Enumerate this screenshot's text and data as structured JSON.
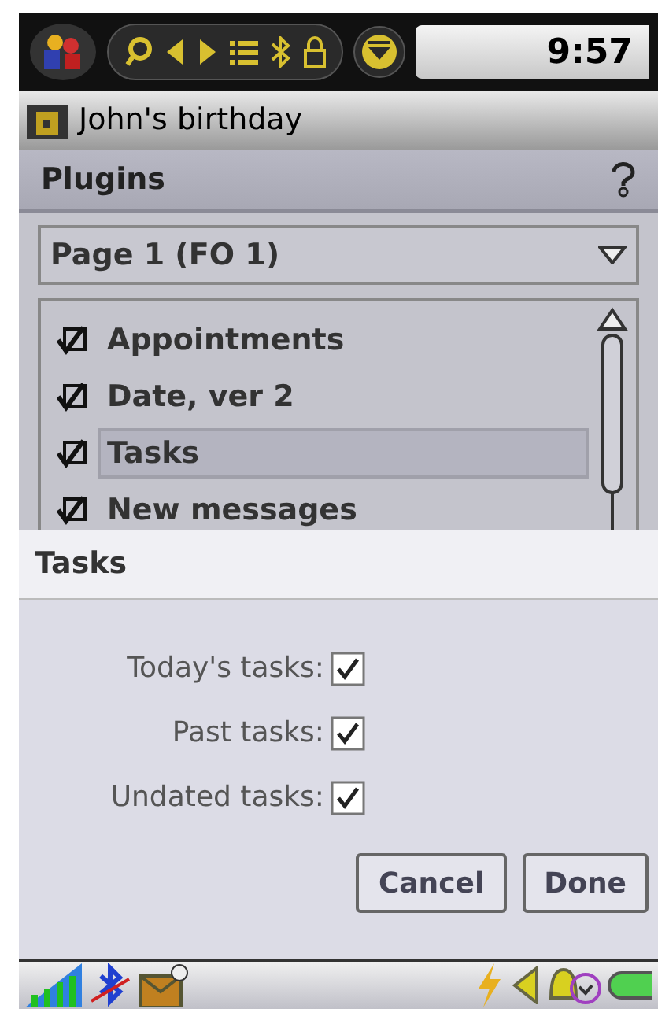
{
  "top_bar": {
    "time": "9:57"
  },
  "title_bar": {
    "title": "John's birthday"
  },
  "plugins": {
    "title": "Plugins",
    "page_select": {
      "value": "Page 1 (FO 1)"
    },
    "items": [
      {
        "label": "Appointments",
        "checked": true,
        "selected": false
      },
      {
        "label": "Date, ver 2",
        "checked": true,
        "selected": false
      },
      {
        "label": "Tasks",
        "checked": true,
        "selected": true
      },
      {
        "label": "New messages",
        "checked": true,
        "selected": false
      }
    ]
  },
  "dialog": {
    "title": "Tasks",
    "options": [
      {
        "label": "Today's tasks:",
        "checked": true
      },
      {
        "label": "Past tasks:",
        "checked": true
      },
      {
        "label": "Undated tasks:",
        "checked": true
      }
    ],
    "buttons": [
      "Cancel",
      "Done"
    ]
  }
}
